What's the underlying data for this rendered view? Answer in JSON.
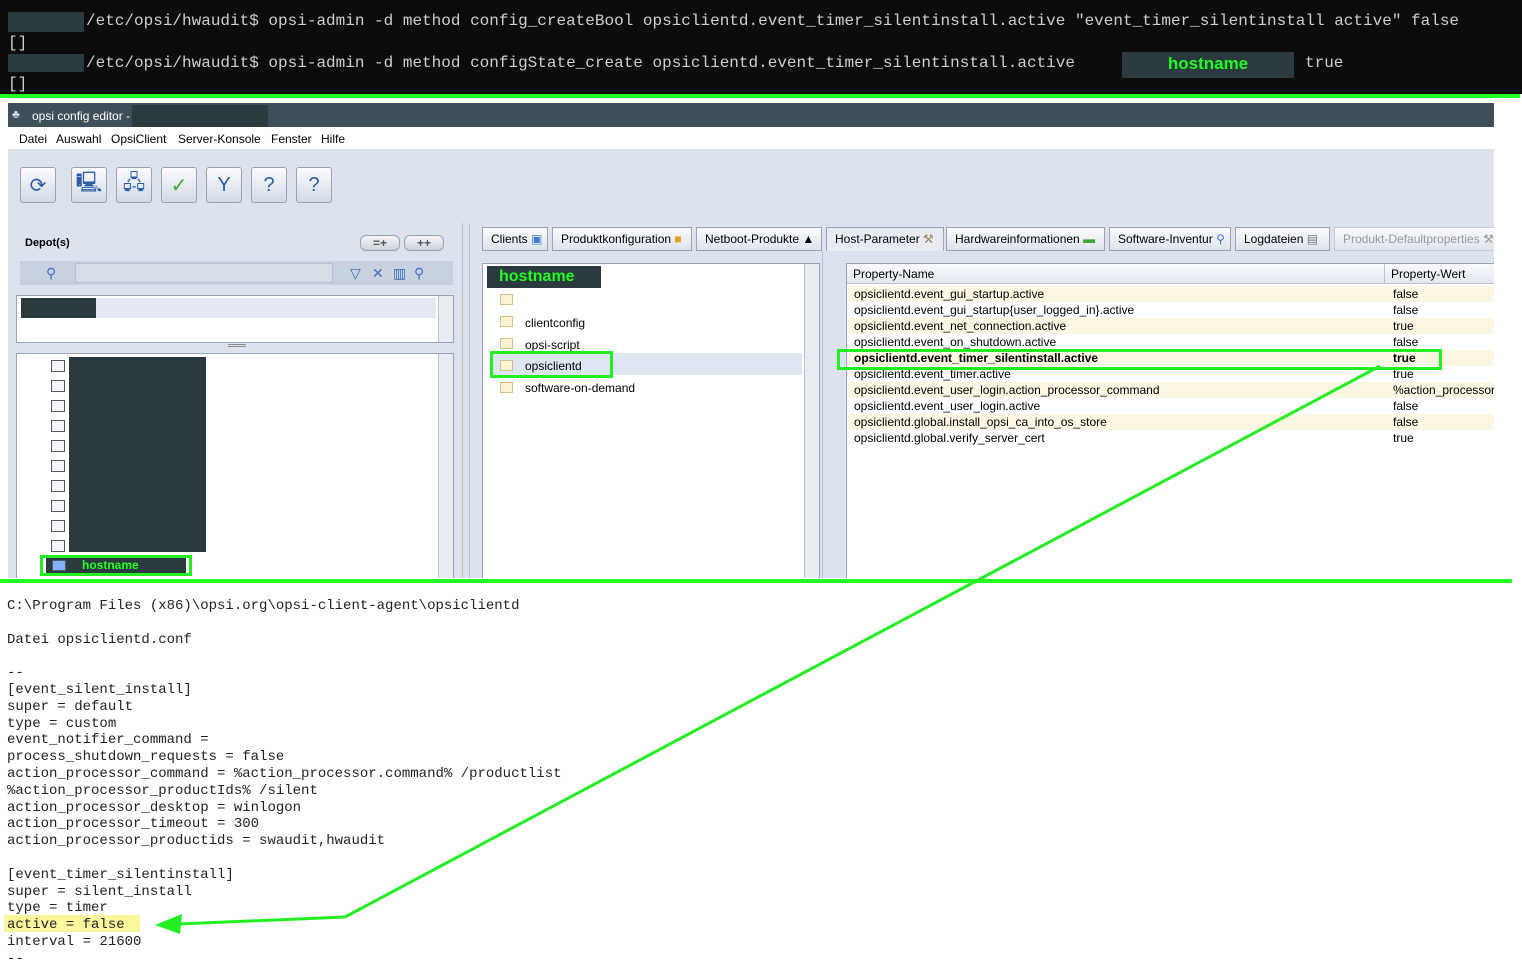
{
  "terminal": {
    "lines": [
      "/etc/opsi/hwaudit$ opsi-admin -d method config_createBool opsiclientd.event_timer_silentinstall.active \"event_timer_silentinstall active\" false",
      "[]",
      "/etc/opsi/hwaudit$ opsi-admin -d method configState_create opsiclientd.event_timer_silentinstall.active",
      "[]"
    ],
    "host_label": "hostname",
    "trailing_value": "true"
  },
  "window": {
    "title": "opsi config editor -",
    "menu": [
      "Datei",
      "Auswahl",
      "OpsiClient",
      "Server-Konsole",
      "Fenster",
      "Hilfe"
    ],
    "toolbar_icons": [
      "refresh-icon",
      "new-client-icon",
      "client-network-icon",
      "save-check-icon",
      "filter-icon",
      "help-network-icon",
      "help-users-icon"
    ]
  },
  "left_pane": {
    "depot_label": "Depot(s)",
    "btn_a": "=+",
    "btn_b": "++",
    "selected_client": "hostname"
  },
  "tabs": [
    "Clients",
    "Produktkonfiguration",
    "Netboot-Produkte",
    "Host-Parameter",
    "Hardwareinformationen",
    "Software-Inventur",
    "Logdateien",
    "Produkt-Defaultproperties"
  ],
  "group_tree": {
    "root": "hostname",
    "items": [
      "",
      "clientconfig",
      "opsi-script",
      "opsiclientd",
      "software-on-demand"
    ]
  },
  "properties": {
    "headers": [
      "Property-Name",
      "Property-Wert"
    ],
    "rows": [
      {
        "name": "opsiclientd.event_gui_startup.active",
        "value": "false"
      },
      {
        "name": "opsiclientd.event_gui_startup{user_logged_in}.active",
        "value": "false"
      },
      {
        "name": "opsiclientd.event_net_connection.active",
        "value": "true"
      },
      {
        "name": "opsiclientd.event_on_shutdown.active",
        "value": "false"
      },
      {
        "name": "opsiclientd.event_timer_silentinstall.active",
        "value": "true"
      },
      {
        "name": "opsiclientd.event_timer.active",
        "value": "true"
      },
      {
        "name": "opsiclientd.event_user_login.action_processor_command",
        "value": "%action_processor."
      },
      {
        "name": "opsiclientd.event_user_login.active",
        "value": "false"
      },
      {
        "name": "opsiclientd.global.install_opsi_ca_into_os_store",
        "value": "false"
      },
      {
        "name": "opsiclientd.global.verify_server_cert",
        "value": "true"
      }
    ]
  },
  "config_file": {
    "lines": [
      "C:\\Program Files (x86)\\opsi.org\\opsi-client-agent\\opsiclientd",
      "",
      "Datei opsiclientd.conf",
      "",
      "--",
      "[event_silent_install]",
      "super = default",
      "type = custom",
      "event_notifier_command =",
      "process_shutdown_requests = false",
      "action_processor_command = %action_processor.command% /productlist",
      "%action_processor_productIds% /silent",
      "action_processor_desktop = winlogon",
      "action_processor_timeout = 300",
      "action_processor_productids = swaudit,hwaudit",
      "",
      "[event_timer_silentinstall]",
      "super = silent_install",
      "type = timer",
      "active = false",
      "interval = 21600",
      "--"
    ]
  },
  "colors": {
    "highlight": "#22ee22",
    "redact": "#2a3a3e"
  }
}
